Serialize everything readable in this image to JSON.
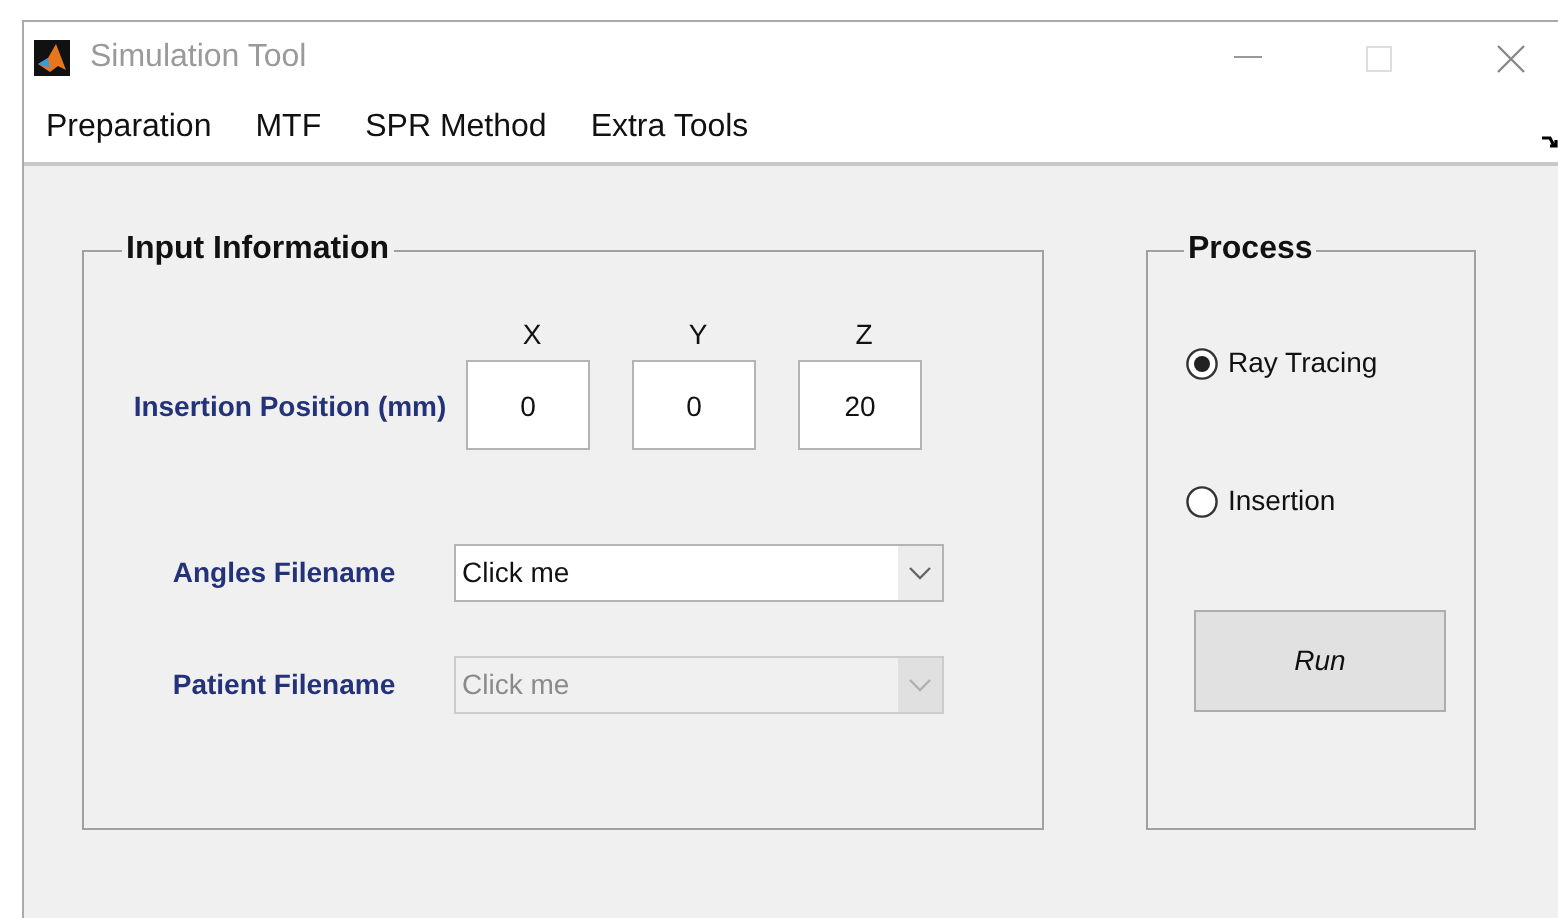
{
  "window": {
    "title": "Simulation Tool"
  },
  "menu": [
    "Preparation",
    "MTF",
    "SPR Method",
    "Extra Tools"
  ],
  "input_panel": {
    "title": "Input Information",
    "position_label": "Insertion Position (mm)",
    "axes": [
      {
        "label": "X",
        "value": "0"
      },
      {
        "label": "Y",
        "value": "0"
      },
      {
        "label": "Z",
        "value": "20"
      }
    ],
    "dropdowns": [
      {
        "label": "Angles Filename",
        "value": "Click me",
        "disabled": false
      },
      {
        "label": "Patient Filename",
        "value": "Click me",
        "disabled": true
      }
    ]
  },
  "process_panel": {
    "title": "Process",
    "options": [
      {
        "label": "Ray Tracing",
        "selected": true
      },
      {
        "label": "Insertion",
        "selected": false
      }
    ],
    "run_button": "Run"
  }
}
